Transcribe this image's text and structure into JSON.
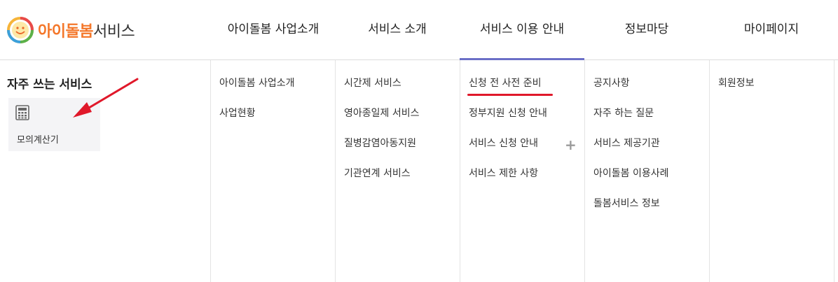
{
  "logo": {
    "brand_colored": "아이돌봄",
    "brand_rest": "서비스"
  },
  "gnb": [
    {
      "label": "아이돌봄 사업소개"
    },
    {
      "label": "서비스 소개"
    },
    {
      "label": "서비스 이용 안내",
      "active": true
    },
    {
      "label": "정보마당"
    },
    {
      "label": "마이페이지"
    }
  ],
  "quick": {
    "title": "자주 쓰는 서비스",
    "items": [
      {
        "label": "모의계산기",
        "icon": "calculator-icon"
      }
    ]
  },
  "columns": [
    {
      "items": [
        "아이돌봄 사업소개",
        "사업현황"
      ]
    },
    {
      "items": [
        "시간제 서비스",
        "영아종일제 서비스",
        "질병감염아동지원",
        "기관연계 서비스"
      ]
    },
    {
      "items": [
        "신청 전 사전 준비",
        "정부지원 신청 안내",
        "서비스 신청 안내",
        "서비스 제한 사항"
      ]
    },
    {
      "items": [
        "공지사항",
        "자주 하는 질문",
        "서비스 제공기관",
        "아이돌봄 이용사례",
        "돌봄서비스 정보"
      ]
    },
    {
      "items": [
        "회원정보"
      ]
    }
  ],
  "expand_symbol": "+",
  "colors": {
    "active_tab": "#6b6fc7",
    "highlight_underline": "#e0182a",
    "annotation_arrow": "#e0182a",
    "brand_orange": "#f4772a"
  }
}
